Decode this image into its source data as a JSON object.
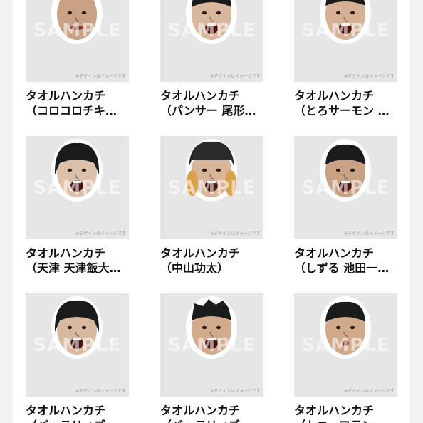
{
  "products": [
    {
      "title": "タオルハンカチ",
      "subtitle": "（コロコロチキ…",
      "watermark": "SAMPLE",
      "note": "※デザインはイメージです",
      "skin": "#c9a184",
      "hair": "none",
      "mouth": "closed"
    },
    {
      "title": "タオルハンカチ",
      "subtitle": "（パンサー 尾形…",
      "watermark": "SAMPLE",
      "note": "※デザインはイメージです",
      "skin": "#d9b79e",
      "hair": "short",
      "mouth": "open"
    },
    {
      "title": "タオルハンカチ",
      "subtitle": "（とろサーモン …",
      "watermark": "SAMPLE",
      "note": "※デザインはイメージです",
      "skin": "#d6b094",
      "hair": "spiky",
      "mouth": "open"
    },
    {
      "title": "タオルハンカチ",
      "subtitle": "（天津 天津飯大…",
      "watermark": "SAMPLE",
      "note": "※デザインはイメージです",
      "skin": "#dcc0aa",
      "hair": "bowl",
      "mouth": "open"
    },
    {
      "title": "タオルハンカチ",
      "subtitle": "（中山功太）",
      "watermark": "SAMPLE",
      "note": "※デザインはイメージです",
      "skin": "#d8b498",
      "hair": "cap",
      "mouth": "open"
    },
    {
      "title": "タオルハンカチ",
      "subtitle": "（しずる 池田一…",
      "watermark": "SAMPLE",
      "note": "※デザインはイメージです",
      "skin": "#c9a184",
      "hair": "short",
      "mouth": "open"
    },
    {
      "title": "タオルハンカチ",
      "subtitle": "（バッテリィズ…",
      "watermark": "SAMPLE",
      "note": "※デザインはイメージです",
      "skin": "#d8b89e",
      "hair": "bob",
      "mouth": "open"
    },
    {
      "title": "タオルハンカチ",
      "subtitle": "（バッテリィズ…",
      "watermark": "SAMPLE",
      "note": "※デザインはイメージです",
      "skin": "#d2aa8c",
      "hair": "spiky",
      "mouth": "open"
    },
    {
      "title": "タオルハンカチ",
      "subtitle": "（トニーフラン…",
      "watermark": "SAMPLE",
      "note": "※デザインはイメージです",
      "skin": "#d0a98b",
      "hair": "short",
      "mouth": "pout"
    }
  ]
}
